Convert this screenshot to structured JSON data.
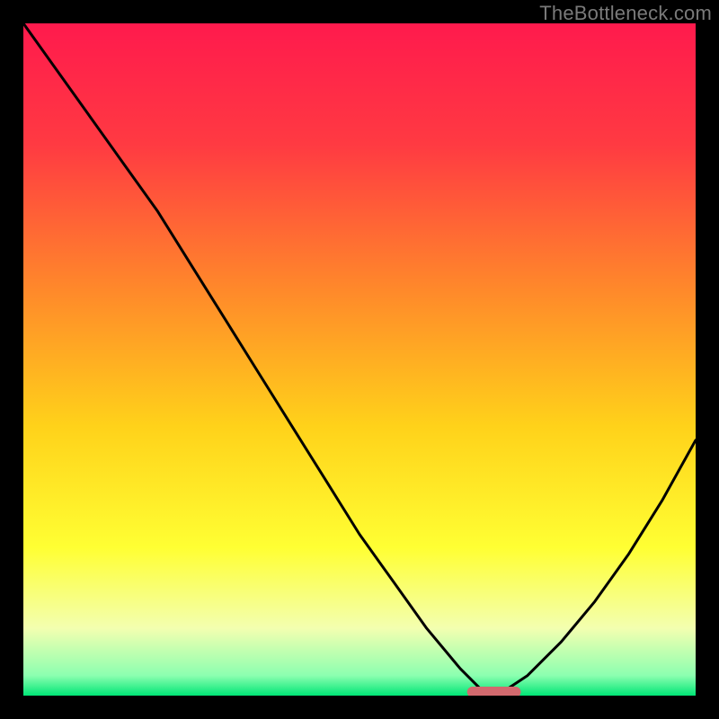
{
  "watermark": "TheBottleneck.com",
  "colors": {
    "background": "#000000",
    "watermark": "#7a7a7a",
    "gradient_stops": [
      {
        "offset": 0.0,
        "color": "#ff1a4d"
      },
      {
        "offset": 0.18,
        "color": "#ff3a42"
      },
      {
        "offset": 0.4,
        "color": "#ff8a2a"
      },
      {
        "offset": 0.6,
        "color": "#ffd21a"
      },
      {
        "offset": 0.78,
        "color": "#ffff33"
      },
      {
        "offset": 0.9,
        "color": "#f3ffb0"
      },
      {
        "offset": 0.97,
        "color": "#8cffb0"
      },
      {
        "offset": 1.0,
        "color": "#00e676"
      }
    ],
    "curve": "#000000",
    "marker": "#d2696e"
  },
  "chart_data": {
    "type": "line",
    "title": "",
    "xlabel": "",
    "ylabel": "",
    "x": [
      0.0,
      0.05,
      0.1,
      0.15,
      0.2,
      0.25,
      0.3,
      0.35,
      0.4,
      0.45,
      0.5,
      0.55,
      0.6,
      0.65,
      0.68,
      0.7,
      0.72,
      0.75,
      0.8,
      0.85,
      0.9,
      0.95,
      1.0
    ],
    "values": [
      1.0,
      0.93,
      0.86,
      0.79,
      0.72,
      0.64,
      0.56,
      0.48,
      0.4,
      0.32,
      0.24,
      0.17,
      0.1,
      0.04,
      0.01,
      0.0,
      0.01,
      0.03,
      0.08,
      0.14,
      0.21,
      0.29,
      0.38
    ],
    "xlim": [
      0,
      1
    ],
    "ylim": [
      0,
      1
    ],
    "marker": {
      "x_start": 0.66,
      "x_end": 0.74,
      "y": 0.0
    },
    "notes": "x and values are normalized to the plot area (0–1). y=0 at bottom. Axis tick labels are not shown in the image."
  }
}
